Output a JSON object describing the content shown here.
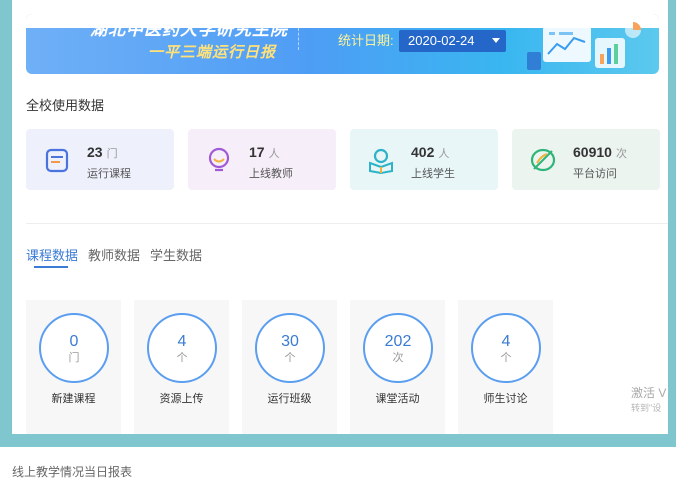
{
  "banner": {
    "title": "湖北中医药大学研究生院",
    "subtitle": "一平三端运行日报",
    "date_label": "统计日期:",
    "date_value": "2020-02-24"
  },
  "section_title": "全校使用数据",
  "stats": [
    {
      "value": "23",
      "unit": "门",
      "label": "运行课程",
      "icon": "course-list-icon"
    },
    {
      "value": "17",
      "unit": "人",
      "label": "上线教师",
      "icon": "teacher-chat-icon"
    },
    {
      "value": "402",
      "unit": "人",
      "label": "上线学生",
      "icon": "student-book-icon"
    },
    {
      "value": "60910",
      "unit": "次",
      "label": "平台访问",
      "icon": "visit-leaf-icon"
    }
  ],
  "tabs": [
    {
      "label": "课程数据",
      "active": true
    },
    {
      "label": "教师数据",
      "active": false
    },
    {
      "label": "学生数据",
      "active": false
    }
  ],
  "metrics": [
    {
      "value": "0",
      "unit": "门",
      "label": "新建课程"
    },
    {
      "value": "4",
      "unit": "个",
      "label": "资源上传"
    },
    {
      "value": "30",
      "unit": "个",
      "label": "运行班级"
    },
    {
      "value": "202",
      "unit": "次",
      "label": "课堂活动"
    },
    {
      "value": "4",
      "unit": "个",
      "label": "师生讨论"
    }
  ],
  "watermark": {
    "line1": "激活 V",
    "line2": "转到\"设"
  },
  "caption": "线上教学情况当日报表",
  "colors": {
    "accent": "#3a7bd5",
    "ring": "#5b9ef0",
    "frame": "#7fc6cf"
  }
}
